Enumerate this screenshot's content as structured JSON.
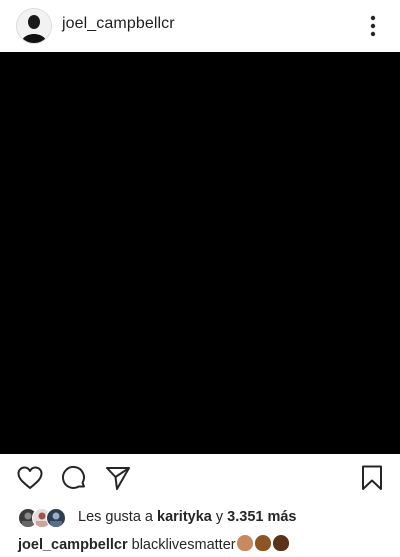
{
  "post": {
    "username": "joel_campbellcr",
    "image_color": "#000000"
  },
  "icons": {
    "more": "more-vertical-icon",
    "like": "heart-icon",
    "comment": "comment-icon",
    "share": "paper-plane-icon",
    "save": "bookmark-icon"
  },
  "likes": {
    "prefix": "Les gusta a",
    "liker": "karityka",
    "connector": "y",
    "count": "3.351 más"
  },
  "caption": {
    "username": "joel_campbellcr",
    "text": "blacklivesmatter",
    "emoji_colors": [
      "#c68a5e",
      "#8d5524",
      "#5b3318"
    ]
  }
}
